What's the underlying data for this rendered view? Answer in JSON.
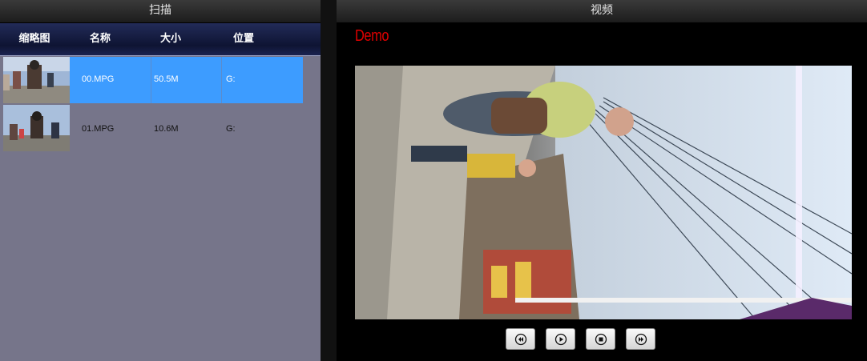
{
  "left_panel": {
    "title": "扫描",
    "columns": [
      "缩略图",
      "名称",
      "大小",
      "位置"
    ],
    "files": [
      {
        "name": "00.MPG",
        "size": "50.5M",
        "location": "G:",
        "selected": true
      },
      {
        "name": "01.MPG",
        "size": "10.6M",
        "location": "G:",
        "selected": false
      }
    ]
  },
  "right_panel": {
    "title": "视频",
    "watermark": "Demo",
    "controls": [
      "rewind-icon",
      "play-icon",
      "stop-icon",
      "fast-forward-icon"
    ]
  },
  "colors": {
    "selection": "#3d9cff",
    "watermark": "#e00000",
    "list_bg": "#76758a"
  }
}
